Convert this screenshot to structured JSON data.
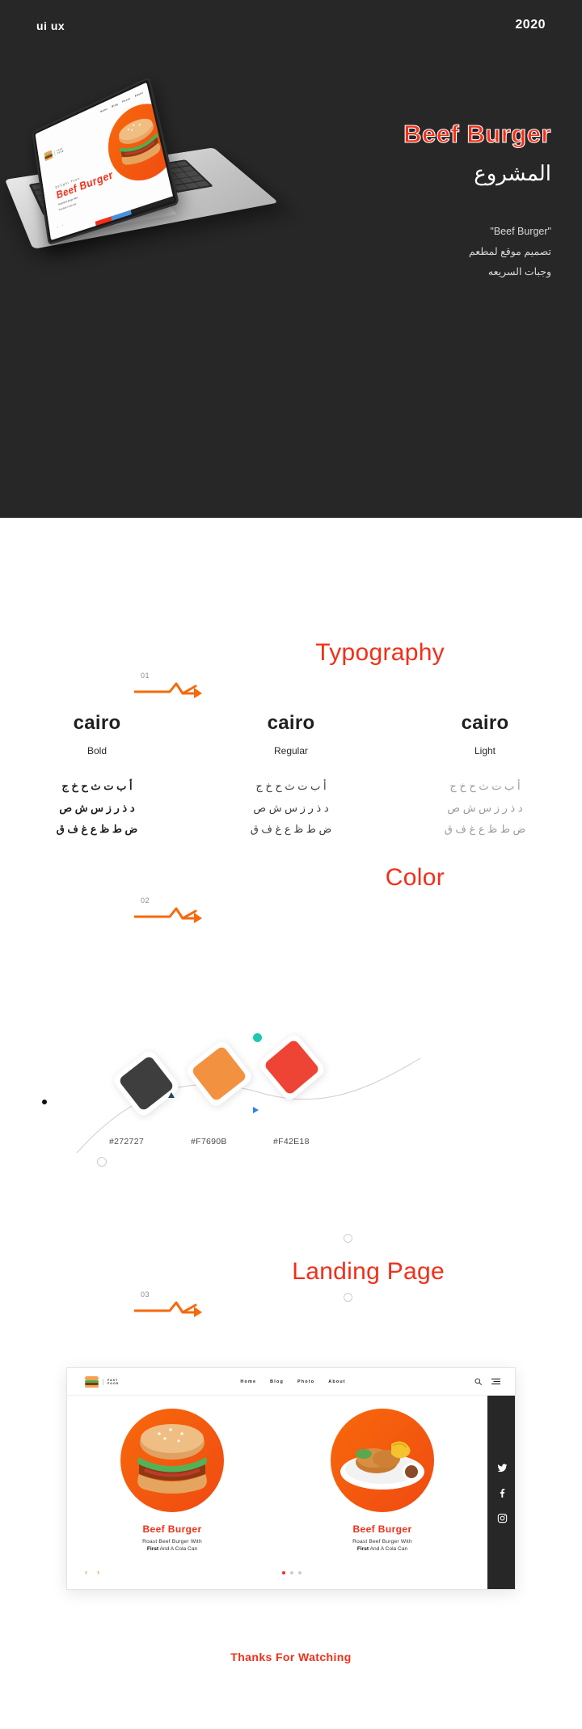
{
  "header": {
    "tag": "ui ux",
    "year": "2020"
  },
  "hero": {
    "title": "Beef Burger",
    "subtitle_ar": "المشروع",
    "desc_quoted": "\"Beef Burger\"",
    "desc_line1": "تصميم موقع لمطعم",
    "desc_line2": "وجبات السريعه",
    "mockup": {
      "logo_line1": "FAST",
      "logo_line2": "FOOD",
      "nav": [
        "Home",
        "Blog",
        "Photo",
        "About"
      ],
      "eyebrow": "Delight  Youn",
      "headline": "Beef Burger",
      "sub_line1": "Roast Beef Burger With",
      "sub_line2": "First And A Cola Can",
      "prev_icon": "chevron-left-icon",
      "next_icon": "chevron-right-icon"
    }
  },
  "sections": [
    {
      "num": "01",
      "title": "Typography",
      "arrow_icon": "zigzag-arrow-icon"
    },
    {
      "num": "02",
      "title": "Color",
      "arrow_icon": "zigzag-arrow-icon"
    },
    {
      "num": "03",
      "title": "Landing Page",
      "arrow_icon": "zigzag-arrow-icon"
    }
  ],
  "typography": {
    "specimens": [
      {
        "family": "cairo",
        "weight": "Bold",
        "rows": [
          "أ ب ت ث ح خ ج",
          "د ذ ر ز س ش ص",
          "ض ط ظ ع غ ف ق"
        ]
      },
      {
        "family": "cairo",
        "weight": "Regular",
        "rows": [
          "أ ب ت ث ح خ ج",
          "د ذ ر ز س ش ص",
          "ض ط ظ ع غ ف ق"
        ]
      },
      {
        "family": "cairo",
        "weight": "Light",
        "rows": [
          "أ ب ت ث ح خ ج",
          "د ذ ر ز س ش ص",
          "ض ط ظ ع غ ف ق"
        ]
      }
    ]
  },
  "colors": {
    "swatches": [
      {
        "hex": "#272727",
        "label": "#272727",
        "name": "dark-swatch"
      },
      {
        "hex": "#F7690B",
        "label": "#F7690B",
        "name": "orange-swatch"
      },
      {
        "hex": "#F42E18",
        "label": "#F42E18",
        "name": "red-swatch"
      }
    ],
    "accent_teal": "#1EC9B0",
    "accent_blue": "#2F80ED"
  },
  "landing": {
    "logo_line1": "FAST",
    "logo_line2": "FOOD",
    "nav": [
      "Home",
      "Blog",
      "Photo",
      "About"
    ],
    "search_icon": "search-icon",
    "menu_icon": "hamburger-menu-icon",
    "social": [
      "twitter-icon",
      "facebook-icon",
      "instagram-icon"
    ],
    "cards": [
      {
        "title": "Beef Burger",
        "sub1": "Roast Beef Burger With",
        "sub2_light": "First",
        "sub2_bold": " And A Cola Can"
      },
      {
        "title": "Beef Burger",
        "sub1": "Roast Beef Burger With",
        "sub2_light": "First",
        "sub2_bold": " And A Cola Can"
      }
    ],
    "prev_icon": "chevron-left-icon",
    "next_icon": "chevron-right-icon"
  },
  "footer": {
    "thanks": "Thanks For Watching"
  }
}
